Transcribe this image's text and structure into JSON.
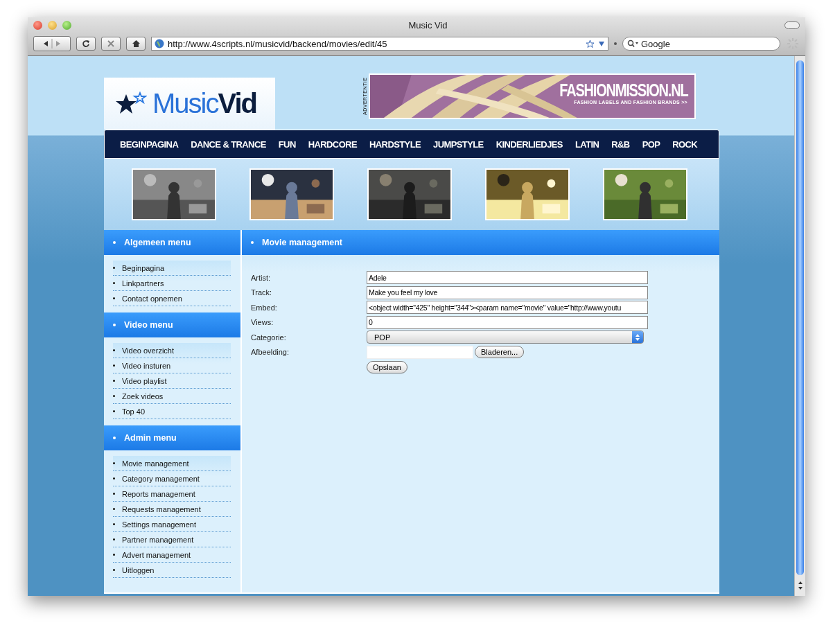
{
  "window": {
    "title": "Music Vid"
  },
  "toolbar": {
    "url": "http://www.4scripts.nl/musicvid/backend/movies/edit/45",
    "search_placeholder": "Google"
  },
  "logo": {
    "first": "Music",
    "second": "Vid"
  },
  "ad": {
    "label": "ADVERTENTIE",
    "brand": "FASHIONMISSION.NL",
    "tagline": "FASHION LABELS AND FASHION BRANDS >>"
  },
  "nav": [
    {
      "label": "BEGINPAGINA"
    },
    {
      "label": "DANCE & TRANCE"
    },
    {
      "label": "FUN"
    },
    {
      "label": "HARDCORE"
    },
    {
      "label": "HARDSTYLE"
    },
    {
      "label": "JUMPSTYLE"
    },
    {
      "label": "KINDERLIEDJES"
    },
    {
      "label": "LATIN"
    },
    {
      "label": "R&B"
    },
    {
      "label": "POP"
    },
    {
      "label": "ROCK"
    }
  ],
  "sidebar": [
    {
      "title": "Algemeen menu",
      "items": [
        "Beginpagina",
        "Linkpartners",
        "Contact opnemen"
      ]
    },
    {
      "title": "Video menu",
      "items": [
        "Video overzicht",
        "Video insturen",
        "Video playlist",
        "Zoek videos",
        "Top 40"
      ]
    },
    {
      "title": "Admin menu",
      "items": [
        "Movie management",
        "Category management",
        "Reports management",
        "Requests management",
        "Settings management",
        "Partner management",
        "Advert management",
        "Uitloggen"
      ]
    }
  ],
  "main": {
    "title": "Movie management",
    "fields": [
      {
        "label": "Artist:",
        "kind": "text",
        "value": "Adele"
      },
      {
        "label": "Track:",
        "kind": "text",
        "value": "Make you feel my love"
      },
      {
        "label": "Embed:",
        "kind": "text",
        "value": "<object width=\"425\" height=\"344\"><param name=\"movie\" value=\"http://www.youtu"
      },
      {
        "label": "Views:",
        "kind": "text",
        "value": "0"
      },
      {
        "label": "Categorie:",
        "kind": "select",
        "value": "POP"
      },
      {
        "label": "Afbeelding:",
        "kind": "file",
        "button": "Bladeren..."
      }
    ],
    "submit": "Opslaan"
  }
}
